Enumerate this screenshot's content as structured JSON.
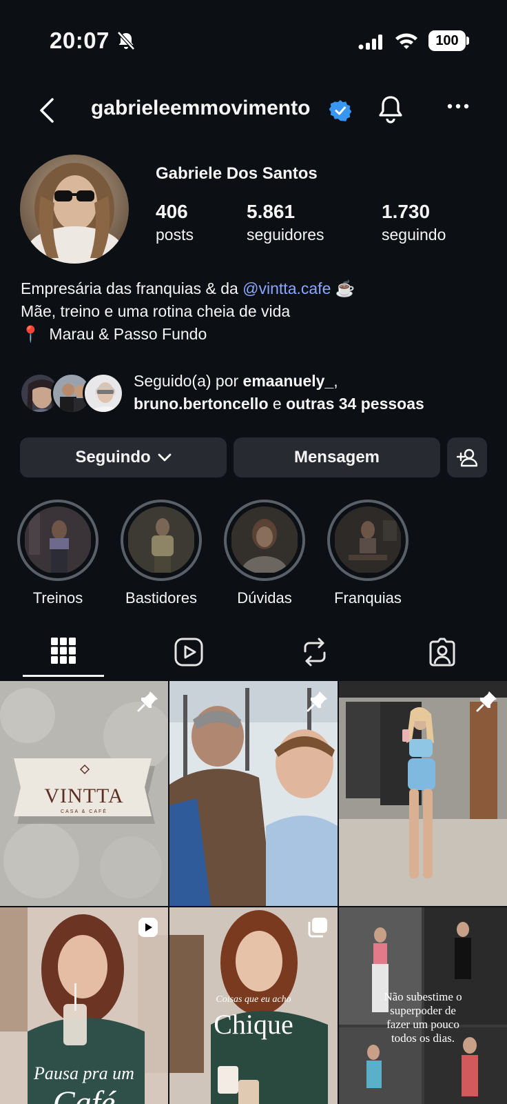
{
  "status": {
    "time": "20:07",
    "battery": "100"
  },
  "header": {
    "username": "gabrieleemmovimento"
  },
  "profile": {
    "full_name": "Gabriele Dos Santos",
    "stats": [
      {
        "value": "406",
        "label": "posts"
      },
      {
        "value": "5.861",
        "label": "seguidores"
      },
      {
        "value": "1.730",
        "label": "seguindo"
      }
    ],
    "bio": {
      "line1_prefix": "Empresária das franquias & da ",
      "line1_link": "@vintta.cafe",
      "line1_emoji": "☕",
      "line2": "Mãe, treino e uma rotina cheia de vida",
      "line3_emoji": "📍",
      "line3": "Marau & Passo Fundo"
    },
    "followed_by": {
      "prefix": "Seguido(a) por ",
      "user1": "emaanuely_",
      "comma": ",",
      "user2": "bruno.bertoncello",
      "conj": " e ",
      "others": "outras 34 pessoas"
    }
  },
  "actions": {
    "following": "Seguindo",
    "message": "Mensagem"
  },
  "highlights": [
    {
      "label": "Treinos"
    },
    {
      "label": "Bastidores"
    },
    {
      "label": "Dúvidas"
    },
    {
      "label": "Franquias"
    }
  ],
  "posts": {
    "tile1_brand": "VINTTA",
    "tile1_sub": "CASA & CAFÉ",
    "tile5_small": "Coisas que eu acho",
    "tile5_big": "Chique",
    "tile4_line1": "Pausa pra um",
    "tile4_line2": "Café",
    "tile6_line1": "Não subestime o",
    "tile6_line2": "superpoder de",
    "tile6_line3": "fazer um pouco",
    "tile6_line4": "todos os dias."
  },
  "colors": {
    "background": "#0c1014",
    "button": "#272b31",
    "link": "#8aa8ff",
    "verified": "#3797f0"
  }
}
